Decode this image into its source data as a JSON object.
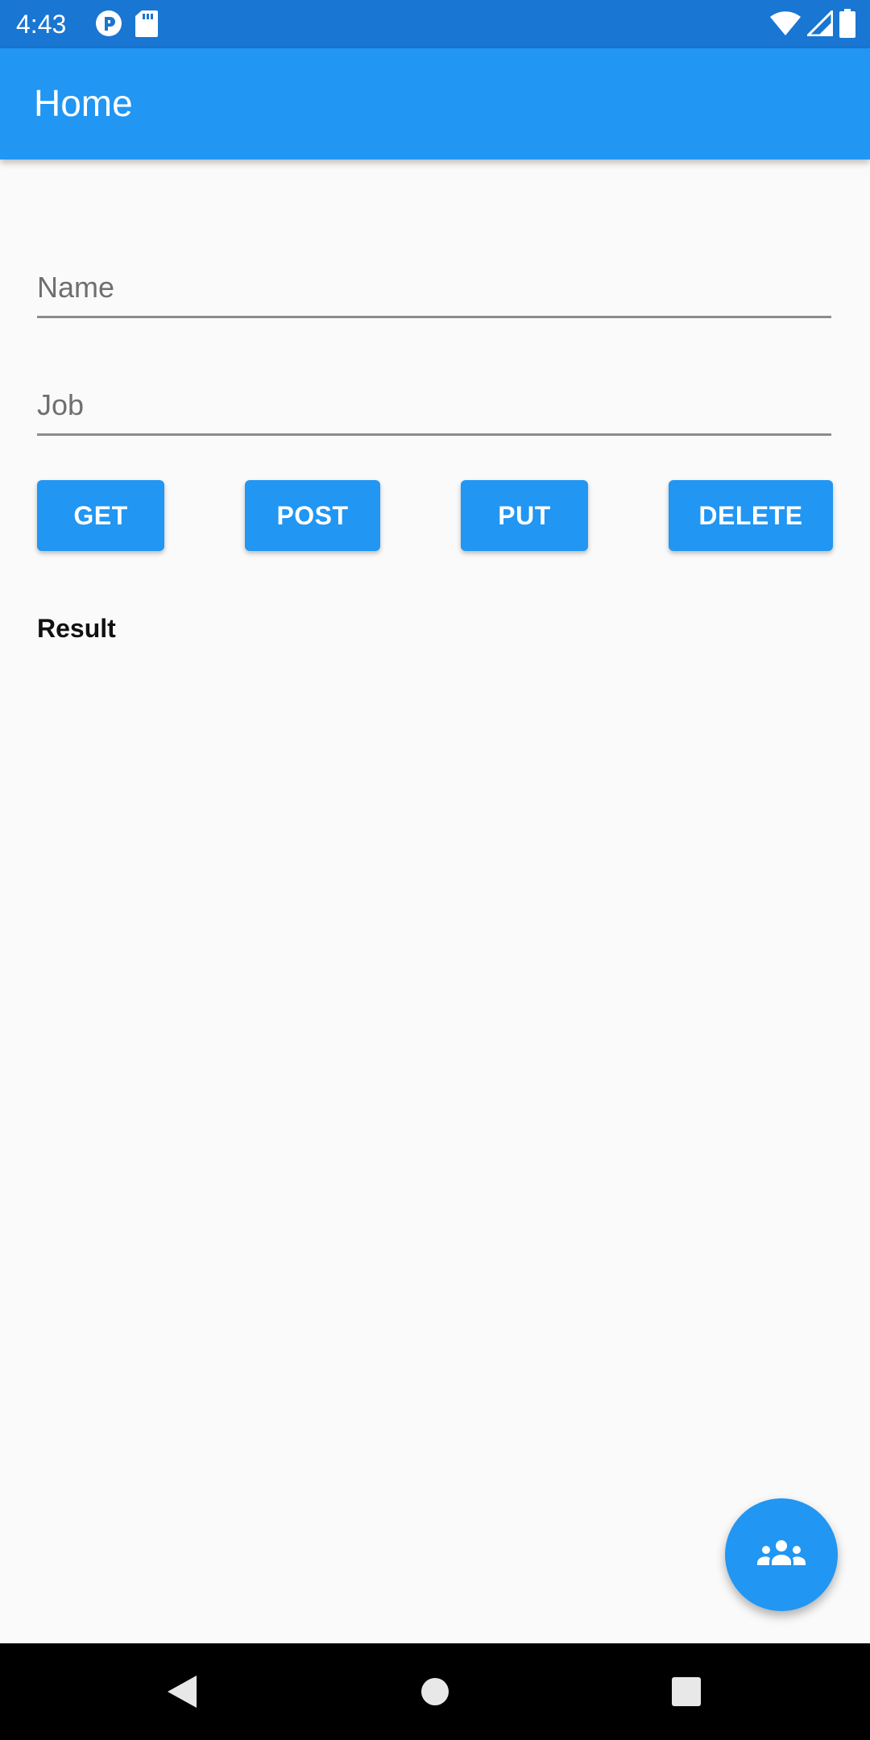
{
  "status_bar": {
    "time": "4:43",
    "icons": [
      "pocket-casts-icon",
      "sd-card-icon",
      "wifi-icon",
      "cell-signal-icon",
      "battery-icon"
    ]
  },
  "app_bar": {
    "title": "Home"
  },
  "form": {
    "name_placeholder": "Name",
    "name_value": "",
    "job_placeholder": "Job",
    "job_value": ""
  },
  "buttons": {
    "get": "GET",
    "post": "POST",
    "put": "PUT",
    "delete": "DELETE"
  },
  "result": {
    "label": "Result"
  },
  "fab": {
    "icon": "group-icon"
  },
  "nav_bar": {
    "icons": [
      "back-icon",
      "home-icon",
      "recents-icon"
    ]
  },
  "colors": {
    "status_bar": "#1976d2",
    "app_bar": "#2196f3",
    "button": "#2196f3",
    "background": "#fafafa",
    "nav_bar": "#000000"
  }
}
